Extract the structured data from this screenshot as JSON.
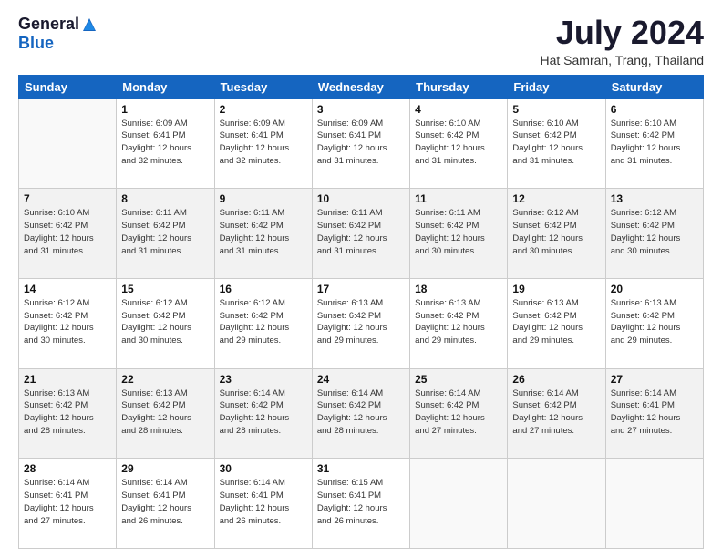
{
  "logo": {
    "general": "General",
    "blue": "Blue"
  },
  "title": {
    "month": "July 2024",
    "location": "Hat Samran, Trang, Thailand"
  },
  "headers": [
    "Sunday",
    "Monday",
    "Tuesday",
    "Wednesday",
    "Thursday",
    "Friday",
    "Saturday"
  ],
  "rows": [
    [
      {
        "num": "",
        "info": "",
        "empty": true
      },
      {
        "num": "1",
        "info": "Sunrise: 6:09 AM\nSunset: 6:41 PM\nDaylight: 12 hours\nand 32 minutes."
      },
      {
        "num": "2",
        "info": "Sunrise: 6:09 AM\nSunset: 6:41 PM\nDaylight: 12 hours\nand 32 minutes."
      },
      {
        "num": "3",
        "info": "Sunrise: 6:09 AM\nSunset: 6:41 PM\nDaylight: 12 hours\nand 31 minutes."
      },
      {
        "num": "4",
        "info": "Sunrise: 6:10 AM\nSunset: 6:42 PM\nDaylight: 12 hours\nand 31 minutes."
      },
      {
        "num": "5",
        "info": "Sunrise: 6:10 AM\nSunset: 6:42 PM\nDaylight: 12 hours\nand 31 minutes."
      },
      {
        "num": "6",
        "info": "Sunrise: 6:10 AM\nSunset: 6:42 PM\nDaylight: 12 hours\nand 31 minutes."
      }
    ],
    [
      {
        "num": "7",
        "info": "Sunrise: 6:10 AM\nSunset: 6:42 PM\nDaylight: 12 hours\nand 31 minutes."
      },
      {
        "num": "8",
        "info": "Sunrise: 6:11 AM\nSunset: 6:42 PM\nDaylight: 12 hours\nand 31 minutes."
      },
      {
        "num": "9",
        "info": "Sunrise: 6:11 AM\nSunset: 6:42 PM\nDaylight: 12 hours\nand 31 minutes."
      },
      {
        "num": "10",
        "info": "Sunrise: 6:11 AM\nSunset: 6:42 PM\nDaylight: 12 hours\nand 31 minutes."
      },
      {
        "num": "11",
        "info": "Sunrise: 6:11 AM\nSunset: 6:42 PM\nDaylight: 12 hours\nand 30 minutes."
      },
      {
        "num": "12",
        "info": "Sunrise: 6:12 AM\nSunset: 6:42 PM\nDaylight: 12 hours\nand 30 minutes."
      },
      {
        "num": "13",
        "info": "Sunrise: 6:12 AM\nSunset: 6:42 PM\nDaylight: 12 hours\nand 30 minutes."
      }
    ],
    [
      {
        "num": "14",
        "info": "Sunrise: 6:12 AM\nSunset: 6:42 PM\nDaylight: 12 hours\nand 30 minutes."
      },
      {
        "num": "15",
        "info": "Sunrise: 6:12 AM\nSunset: 6:42 PM\nDaylight: 12 hours\nand 30 minutes."
      },
      {
        "num": "16",
        "info": "Sunrise: 6:12 AM\nSunset: 6:42 PM\nDaylight: 12 hours\nand 29 minutes."
      },
      {
        "num": "17",
        "info": "Sunrise: 6:13 AM\nSunset: 6:42 PM\nDaylight: 12 hours\nand 29 minutes."
      },
      {
        "num": "18",
        "info": "Sunrise: 6:13 AM\nSunset: 6:42 PM\nDaylight: 12 hours\nand 29 minutes."
      },
      {
        "num": "19",
        "info": "Sunrise: 6:13 AM\nSunset: 6:42 PM\nDaylight: 12 hours\nand 29 minutes."
      },
      {
        "num": "20",
        "info": "Sunrise: 6:13 AM\nSunset: 6:42 PM\nDaylight: 12 hours\nand 29 minutes."
      }
    ],
    [
      {
        "num": "21",
        "info": "Sunrise: 6:13 AM\nSunset: 6:42 PM\nDaylight: 12 hours\nand 28 minutes."
      },
      {
        "num": "22",
        "info": "Sunrise: 6:13 AM\nSunset: 6:42 PM\nDaylight: 12 hours\nand 28 minutes."
      },
      {
        "num": "23",
        "info": "Sunrise: 6:14 AM\nSunset: 6:42 PM\nDaylight: 12 hours\nand 28 minutes."
      },
      {
        "num": "24",
        "info": "Sunrise: 6:14 AM\nSunset: 6:42 PM\nDaylight: 12 hours\nand 28 minutes."
      },
      {
        "num": "25",
        "info": "Sunrise: 6:14 AM\nSunset: 6:42 PM\nDaylight: 12 hours\nand 27 minutes."
      },
      {
        "num": "26",
        "info": "Sunrise: 6:14 AM\nSunset: 6:42 PM\nDaylight: 12 hours\nand 27 minutes."
      },
      {
        "num": "27",
        "info": "Sunrise: 6:14 AM\nSunset: 6:41 PM\nDaylight: 12 hours\nand 27 minutes."
      }
    ],
    [
      {
        "num": "28",
        "info": "Sunrise: 6:14 AM\nSunset: 6:41 PM\nDaylight: 12 hours\nand 27 minutes."
      },
      {
        "num": "29",
        "info": "Sunrise: 6:14 AM\nSunset: 6:41 PM\nDaylight: 12 hours\nand 26 minutes."
      },
      {
        "num": "30",
        "info": "Sunrise: 6:14 AM\nSunset: 6:41 PM\nDaylight: 12 hours\nand 26 minutes."
      },
      {
        "num": "31",
        "info": "Sunrise: 6:15 AM\nSunset: 6:41 PM\nDaylight: 12 hours\nand 26 minutes."
      },
      {
        "num": "",
        "info": "",
        "empty": true
      },
      {
        "num": "",
        "info": "",
        "empty": true
      },
      {
        "num": "",
        "info": "",
        "empty": true
      }
    ]
  ]
}
